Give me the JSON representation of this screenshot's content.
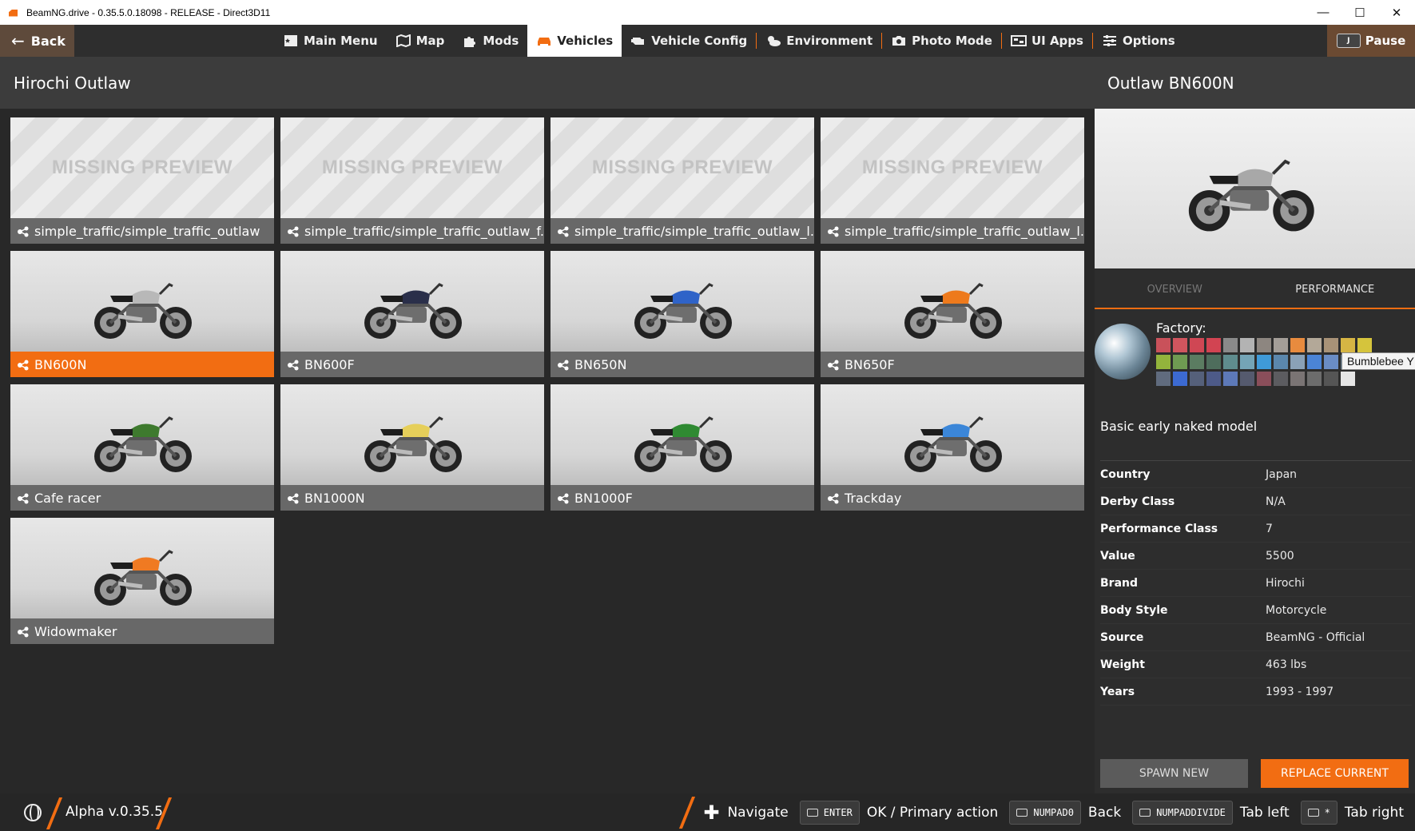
{
  "window": {
    "title": "BeamNG.drive - 0.35.5.0.18098 - RELEASE - Direct3D11",
    "controls": [
      "—",
      "☐",
      "✕"
    ]
  },
  "topnav": {
    "back_label": "Back",
    "items": [
      {
        "label": "Main Menu",
        "icon": "main-menu-icon"
      },
      {
        "label": "Map",
        "icon": "map-icon"
      },
      {
        "label": "Mods",
        "icon": "puzzle-icon"
      },
      {
        "label": "Vehicles",
        "icon": "car-icon",
        "active": true
      },
      {
        "label": "Vehicle Config",
        "icon": "engine-icon"
      },
      {
        "label": "Environment",
        "icon": "weather-icon"
      },
      {
        "label": "Photo Mode",
        "icon": "camera-icon"
      },
      {
        "label": "UI Apps",
        "icon": "ui-apps-icon"
      },
      {
        "label": "Options",
        "icon": "sliders-icon"
      }
    ],
    "pause_label": "Pause",
    "pause_key": "J"
  },
  "list": {
    "title": "Hirochi Outlaw",
    "missing_preview_text": "MISSING PREVIEW",
    "configs": [
      {
        "label": "simple_traffic/simple_traffic_outlaw",
        "preview": "missing"
      },
      {
        "label": "simple_traffic/simple_traffic_outlaw_f...",
        "preview": "missing"
      },
      {
        "label": "simple_traffic/simple_traffic_outlaw_l...",
        "preview": "missing"
      },
      {
        "label": "simple_traffic/simple_traffic_outlaw_l...",
        "preview": "missing"
      },
      {
        "label": "BN600N",
        "preview": "bike",
        "color": "#b8b8b8",
        "selected": true
      },
      {
        "label": "BN600F",
        "preview": "bike",
        "color": "#2a2f4a"
      },
      {
        "label": "BN650N",
        "preview": "bike",
        "color": "#2f63c8"
      },
      {
        "label": "BN650F",
        "preview": "bike",
        "color": "#ee7a1c"
      },
      {
        "label": "Cafe racer",
        "preview": "bike",
        "color": "#3e7a2e"
      },
      {
        "label": "BN1000N",
        "preview": "bike",
        "color": "#e6cf5a"
      },
      {
        "label": "BN1000F",
        "preview": "bike",
        "color": "#2f8a32"
      },
      {
        "label": "Trackday",
        "preview": "bike",
        "color": "#3b86d8"
      },
      {
        "label": "Widowmaker",
        "preview": "bike",
        "color": "#f07a22"
      }
    ]
  },
  "detail": {
    "title": "Outlaw BN600N",
    "hero_color": "#a8a8a8",
    "tabs": [
      {
        "label": "OVERVIEW",
        "active": false
      },
      {
        "label": "PERFORMANCE",
        "active": true
      }
    ],
    "paint_label": "Factory:",
    "swatch_rows": [
      [
        "#c9515a",
        "#d0555e",
        "#cf4754",
        "#d24452",
        "#8a8a8a",
        "#b3b3b3",
        "#8d8680",
        "#a49e98",
        "#e88b3e",
        "#b3a898",
        "#a89277",
        "#d6b544",
        "#d5c43c"
      ],
      [
        "#93b43c",
        "#6f9a52",
        "#5b7c61",
        "#4e6d5c",
        "#5f8c8e",
        "#74a4b6",
        "#3f9ad8",
        "#5b87ad",
        "#8aa1b7",
        "#4b84d6",
        "#6a8cc4",
        "#5a7488"
      ],
      [
        "#606b7e",
        "#3c6ad2",
        "#55607a",
        "#4d5a88",
        "#5d79b8",
        "#555a6e",
        "#8a4e5a",
        "#5c5c60",
        "#7a7474",
        "#6c6c6c",
        "#555555",
        "#e6e6e6"
      ]
    ],
    "tooltip": "Bumblebee Y",
    "description": "Basic early naked model",
    "specs": [
      {
        "k": "Country",
        "v": "Japan"
      },
      {
        "k": "Derby Class",
        "v": "N/A"
      },
      {
        "k": "Performance Class",
        "v": "7"
      },
      {
        "k": "Value",
        "v": "5500"
      },
      {
        "k": "Brand",
        "v": "Hirochi"
      },
      {
        "k": "Body Style",
        "v": "Motorcycle"
      },
      {
        "k": "Source",
        "v": "BeamNG - Official"
      },
      {
        "k": "Weight",
        "v": "463 lbs"
      },
      {
        "k": "Years",
        "v": "1993 - 1997"
      }
    ],
    "spawn_label": "SPAWN NEW",
    "replace_label": "REPLACE CURRENT"
  },
  "bottom": {
    "version": "Alpha v.0.35.5",
    "hints": [
      {
        "key": "",
        "text": "Navigate",
        "icon": "dpad-icon"
      },
      {
        "key": "ENTER",
        "text": "OK / Primary action"
      },
      {
        "key": "NUMPAD0",
        "text": "Back"
      },
      {
        "key": "NUMPADDIVIDE",
        "text": "Tab left"
      },
      {
        "key": "*",
        "text": "Tab right"
      }
    ]
  },
  "colors": {
    "accent": "#f26d12",
    "panel": "#3c3c3c",
    "background": "#282828"
  }
}
